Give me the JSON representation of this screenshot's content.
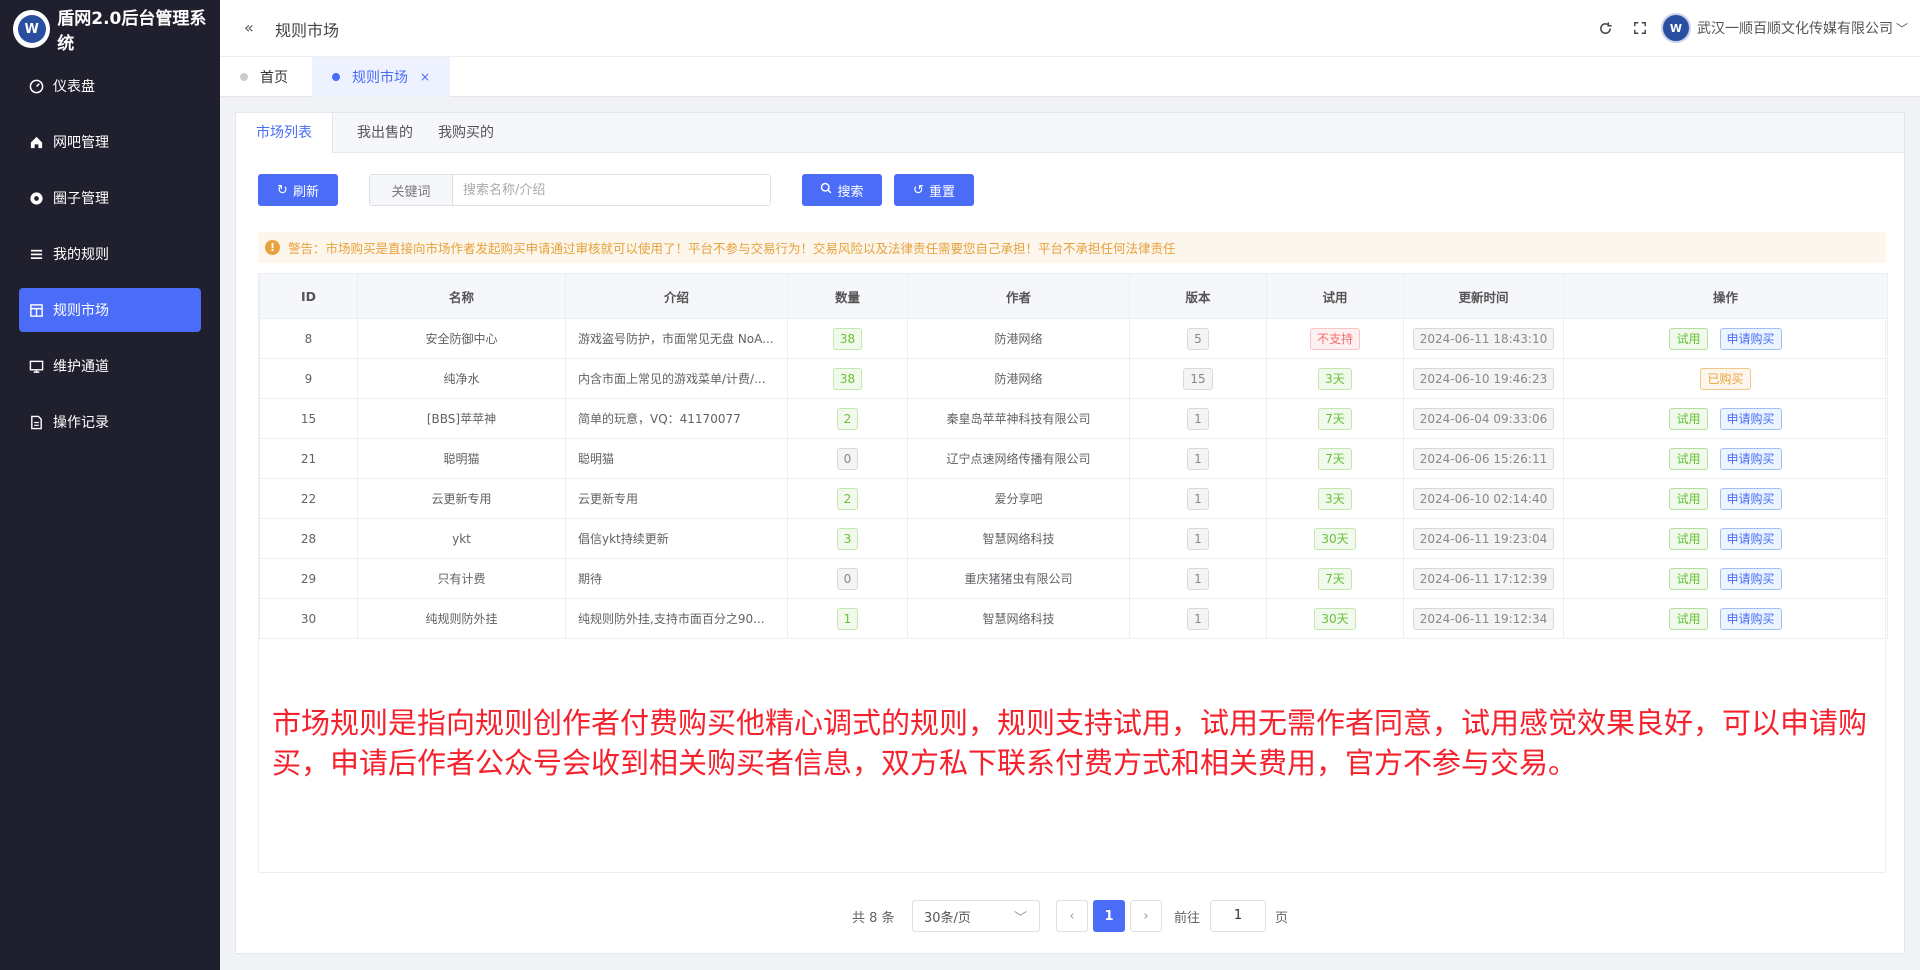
{
  "app": {
    "title": "盾网2.0后台管理系统",
    "logo_glyph": "W"
  },
  "sidebar": {
    "items": [
      {
        "label": "仪表盘",
        "icon": "dashboard-icon"
      },
      {
        "label": "网吧管理",
        "icon": "home-icon"
      },
      {
        "label": "圈子管理",
        "icon": "circle-icon"
      },
      {
        "label": "我的规则",
        "icon": "list-icon"
      },
      {
        "label": "规则市场",
        "icon": "market-icon",
        "active": true
      },
      {
        "label": "维护通道",
        "icon": "monitor-icon"
      },
      {
        "label": "操作记录",
        "icon": "document-icon"
      }
    ]
  },
  "header": {
    "title": "规则市场",
    "company": "武汉一顺百顺文化传媒有限公司"
  },
  "tabs": [
    {
      "label": "首页",
      "close": ""
    },
    {
      "label": "规则市场",
      "close": "×"
    }
  ],
  "subtabs": [
    "市场列表",
    "我出售的",
    "我购买的"
  ],
  "toolbar": {
    "refresh_label": "刷新",
    "search_label": "搜索",
    "reset_label": "重置",
    "keyword_label": "关键词",
    "keyword_placeholder": "搜索名称/介绍",
    "keyword_value": ""
  },
  "warning": "警告：市场购买是直接向市场作者发起购买申请通过审核就可以使用了！平台不参与交易行为！交易风险以及法律责任需要您自己承担！平台不承担任何法律责任",
  "table": {
    "columns": [
      "ID",
      "名称",
      "介绍",
      "数量",
      "作者",
      "版本",
      "试用",
      "更新时间",
      "操作"
    ],
    "try_label": "试用",
    "apply_label": "申请购买",
    "bought_label": "已购买",
    "rows": [
      {
        "id": "8",
        "name": "安全防御中心",
        "intro": "游戏盗号防护，市面常见无盘 NoA...",
        "qty": "38",
        "author": "防港网络",
        "version": "5",
        "trial": "不支持",
        "trial_type": "red",
        "updated": "2024-06-11 18:43:10",
        "bought": false
      },
      {
        "id": "9",
        "name": "纯净水",
        "intro": "内含市面上常见的游戏菜单/计费/...",
        "qty": "38",
        "author": "防港网络",
        "version": "15",
        "trial": "3天",
        "trial_type": "green",
        "updated": "2024-06-10 19:46:23",
        "bought": true
      },
      {
        "id": "15",
        "name": "[BBS]苹苹神",
        "intro": "简单的玩意，VQ：41170077",
        "qty": "2",
        "author": "秦皇岛苹苹神科技有限公司",
        "version": "1",
        "trial": "7天",
        "trial_type": "green",
        "updated": "2024-06-04 09:33:06",
        "bought": false
      },
      {
        "id": "21",
        "name": "聪明猫",
        "intro": "聪明猫",
        "qty": "0",
        "author": "辽宁点速网络传播有限公司",
        "version": "1",
        "trial": "7天",
        "trial_type": "green",
        "updated": "2024-06-06 15:26:11",
        "bought": false
      },
      {
        "id": "22",
        "name": "云更新专用",
        "intro": "云更新专用",
        "qty": "2",
        "author": "爱分享吧",
        "version": "1",
        "trial": "3天",
        "trial_type": "green",
        "updated": "2024-06-10 02:14:40",
        "bought": false
      },
      {
        "id": "28",
        "name": "ykt",
        "intro": "倡信ykt持续更新",
        "qty": "3",
        "author": "智慧网络科技",
        "version": "1",
        "trial": "30天",
        "trial_type": "green",
        "updated": "2024-06-11 19:23:04",
        "bought": false
      },
      {
        "id": "29",
        "name": "只有计费",
        "intro": "期待",
        "qty": "0",
        "author": "重庆猪猪虫有限公司",
        "version": "1",
        "trial": "7天",
        "trial_type": "green",
        "updated": "2024-06-11 17:12:39",
        "bought": false
      },
      {
        "id": "30",
        "name": "纯规则防外挂",
        "intro": "纯规则防外挂,支持市面百分之90...",
        "qty": "1",
        "author": "智慧网络科技",
        "version": "1",
        "trial": "30天",
        "trial_type": "green",
        "updated": "2024-06-11 19:12:34",
        "bought": false
      }
    ]
  },
  "overlay_text": "市场规则是指向规则创作者付费购买他精心调式的规则，规则支持试用，试用无需作者同意，试用感觉效果良好，可以申请购买，申请后作者公众号会收到相关购买者信息，双方私下联系付费方式和相关费用，官方不参与交易。",
  "pagination": {
    "total": "共 8 条",
    "page_size": "30条/页",
    "current": "1",
    "goto_label": "前往",
    "goto_value": "1",
    "page_unit": "页"
  },
  "colors": {
    "primary": "#4a6cf7",
    "sidebar": "#1f1f2e",
    "warning": "#e6a23c",
    "success": "#67c23a",
    "danger": "#f56c6c",
    "annotation": "#f5222d"
  }
}
